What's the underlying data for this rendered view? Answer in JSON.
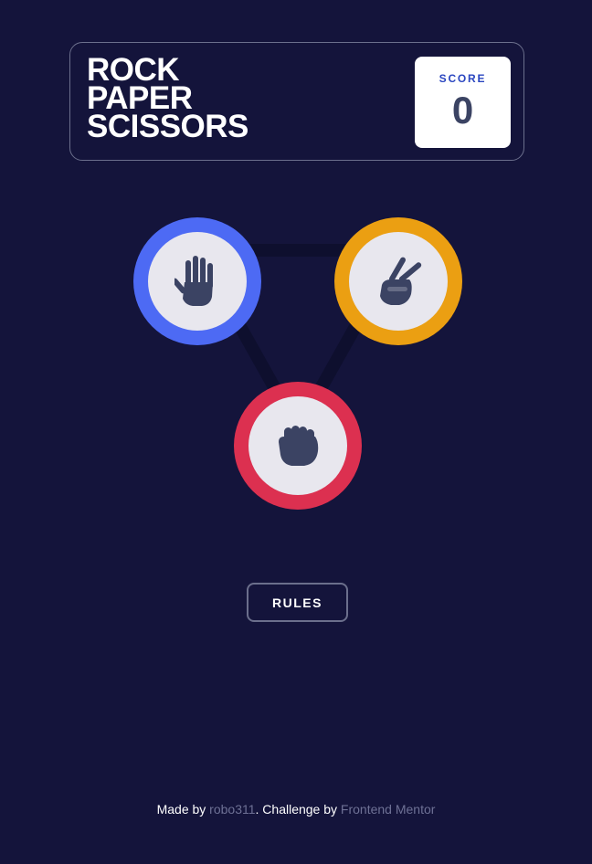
{
  "header": {
    "title_lines": [
      "ROCK",
      "PAPER",
      "SCISSORS"
    ],
    "score_label": "SCORE",
    "score_value": "0"
  },
  "choices": [
    {
      "id": "paper",
      "name": "paper",
      "ring_color": "#4d6af4",
      "icon": "open-hand-icon"
    },
    {
      "id": "scissors",
      "name": "scissors",
      "ring_color": "#eb9f12",
      "icon": "peace-hand-icon"
    },
    {
      "id": "rock",
      "name": "rock",
      "ring_color": "#dc3050",
      "icon": "fist-icon"
    }
  ],
  "rules_button": {
    "label": "RULES"
  },
  "footer": {
    "made_by_prefix": "Made by ",
    "author": "robo311",
    "challenge_prefix": ". Challenge by ",
    "challenge_org": "Frontend Mentor"
  },
  "colors": {
    "background": "#14143b",
    "header_border": "#6b6f8c",
    "score_label": "#2a46c0",
    "score_value": "#3b4363",
    "icon": "#3b4363",
    "link": "#6e7195"
  }
}
